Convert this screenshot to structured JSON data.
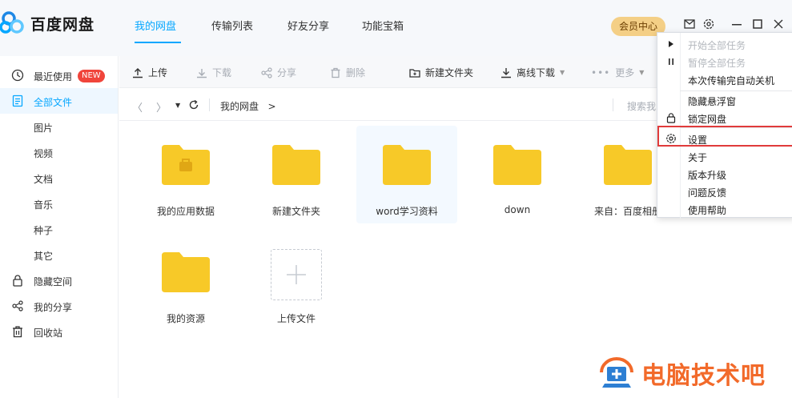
{
  "app": {
    "title": "百度网盘"
  },
  "nav": {
    "tabs": [
      {
        "label": "我的网盘"
      },
      {
        "label": "传输列表"
      },
      {
        "label": "好友分享"
      },
      {
        "label": "功能宝箱"
      }
    ],
    "vip": "会员中心"
  },
  "sidebar": {
    "items": [
      {
        "label": "最近使用",
        "badge": "NEW",
        "icon": "clock-icon"
      },
      {
        "label": "全部文件",
        "icon": "file-icon"
      },
      {
        "label": "图片"
      },
      {
        "label": "视频"
      },
      {
        "label": "文档"
      },
      {
        "label": "音乐"
      },
      {
        "label": "种子"
      },
      {
        "label": "其它"
      },
      {
        "label": "隐藏空间",
        "icon": "lock-icon"
      },
      {
        "label": "我的分享",
        "icon": "share-icon"
      },
      {
        "label": "回收站",
        "icon": "trash-icon"
      }
    ]
  },
  "toolbar": {
    "upload": "上传",
    "download": "下载",
    "share": "分享",
    "delete": "删除",
    "new_folder": "新建文件夹",
    "offline": "离线下载",
    "more": "更多"
  },
  "path": {
    "crumb": "我的网盘",
    "sep": ">",
    "search_placeholder": "搜索我"
  },
  "files": [
    {
      "name": "我的应用数据",
      "type": "app-folder"
    },
    {
      "name": "新建文件夹",
      "type": "folder"
    },
    {
      "name": "word学习资料",
      "type": "folder"
    },
    {
      "name": "down",
      "type": "folder"
    },
    {
      "name": "来自：百度相册",
      "type": "folder"
    },
    {
      "name": "我的资源",
      "type": "folder"
    },
    {
      "name": "上传文件",
      "type": "upload"
    }
  ],
  "menu": {
    "items": [
      {
        "label": "开始全部任务",
        "disabled": true,
        "icon": "play-icon"
      },
      {
        "label": "暂停全部任务",
        "disabled": true,
        "icon": "pause-icon"
      },
      {
        "label": "本次传输完自动关机",
        "disabled": false
      },
      {
        "label": "隐藏悬浮窗",
        "disabled": false
      },
      {
        "label": "锁定网盘",
        "disabled": false,
        "icon": "lock-icon"
      },
      {
        "label": "设置",
        "disabled": false,
        "icon": "gear-icon"
      },
      {
        "label": "关于",
        "disabled": false
      },
      {
        "label": "版本升级",
        "disabled": false
      },
      {
        "label": "问题反馈",
        "disabled": false
      },
      {
        "label": "使用帮助",
        "disabled": false
      }
    ]
  },
  "watermark": {
    "text": "电脑技术吧"
  },
  "colors": {
    "accent": "#06a7ff",
    "folder": "#f7c928",
    "vip": "#f4cf86",
    "badge": "#f0453b",
    "highlight": "#e13b3b",
    "watermark": "#f26a2a"
  }
}
